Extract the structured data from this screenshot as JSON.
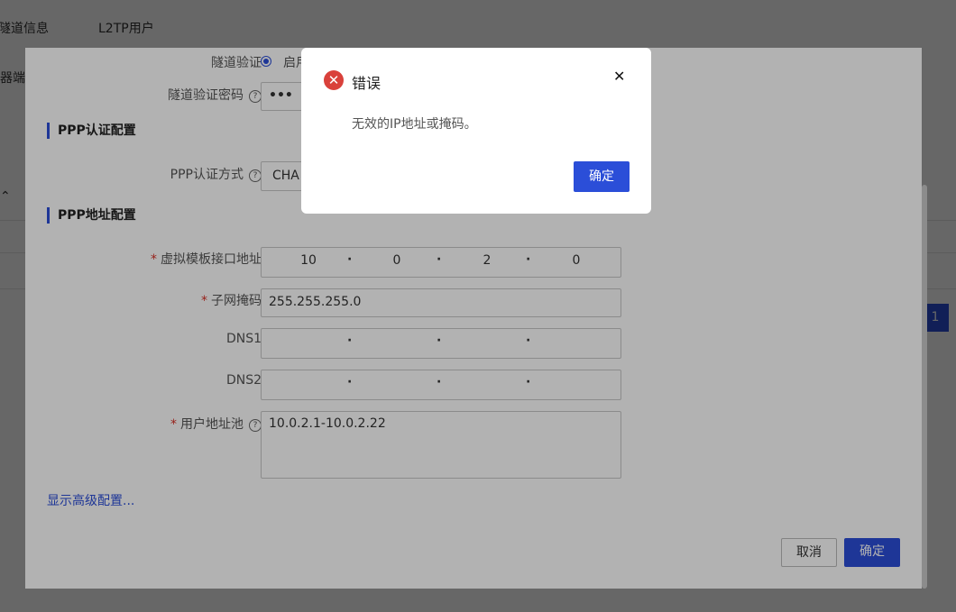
{
  "background": {
    "tabs": [
      "隧道信息",
      "L2TP用户"
    ],
    "side_text": "器端",
    "pager_current": "1"
  },
  "config": {
    "tunnel_auth": {
      "label": "隧道验证",
      "option": "启用"
    },
    "tunnel_password": {
      "label": "隧道验证密码",
      "value": "•••"
    },
    "ppp_auth_section": "PPP认证配置",
    "ppp_auth_mode": {
      "label": "PPP认证方式",
      "value": "CHA"
    },
    "ppp_addr_section": "PPP地址配置",
    "virtual_template": {
      "label": "虚拟模板接口地址",
      "octets": [
        "10",
        "0",
        "2",
        "0"
      ]
    },
    "subnet_mask": {
      "label": "子网掩码",
      "value": "255.255.255.0"
    },
    "dns1": {
      "label": "DNS1",
      "octets": [
        "",
        "",
        "",
        ""
      ]
    },
    "dns2": {
      "label": "DNS2",
      "octets": [
        "",
        "",
        "",
        ""
      ]
    },
    "user_pool": {
      "label": "用户地址池",
      "value": "10.0.2.1-10.0.2.22"
    },
    "advanced_link": "显示高级配置...",
    "cancel_label": "取消",
    "ok_label": "确定"
  },
  "error_modal": {
    "title": "错误",
    "message": "无效的IP地址或掩码。",
    "close_icon": "close-icon",
    "ok_label": "确定"
  },
  "colors": {
    "accent": "#2b4ed8",
    "error": "#d9413b",
    "required": "#d93026"
  }
}
